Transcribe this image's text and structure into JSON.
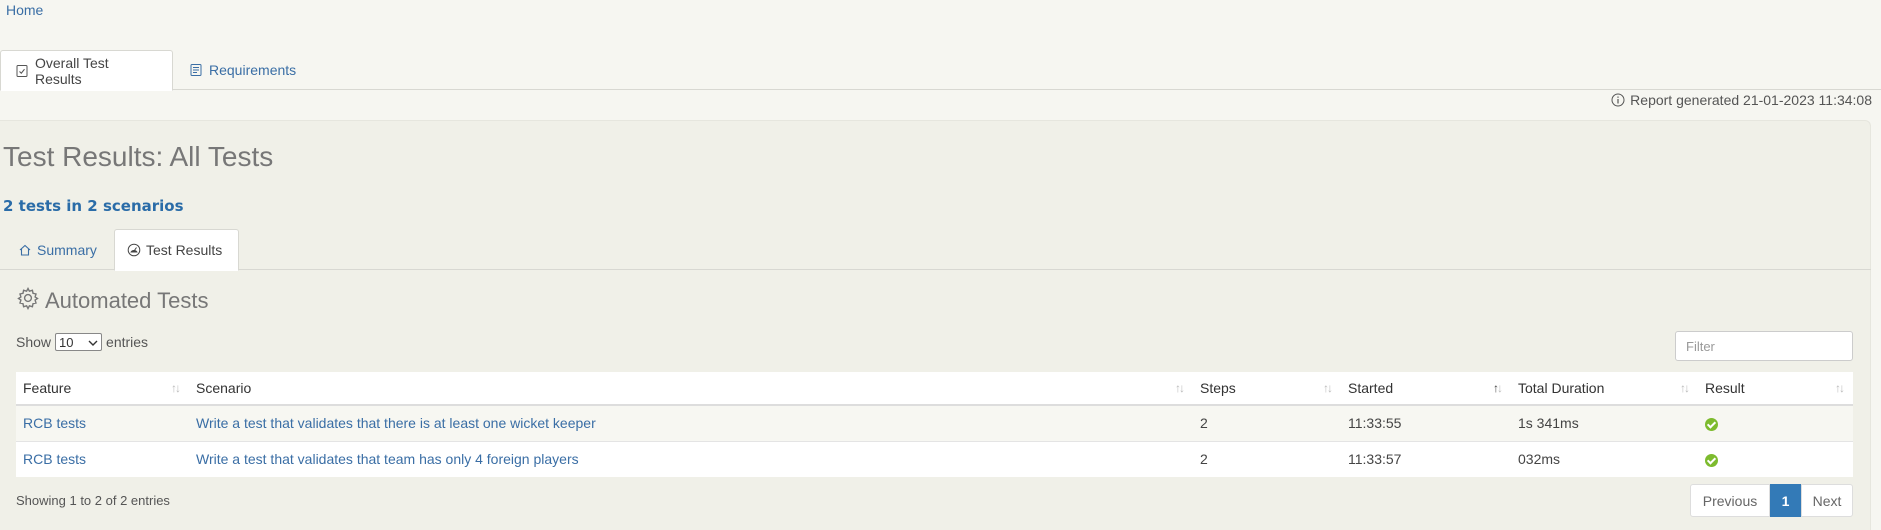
{
  "breadcrumb": {
    "home": "Home"
  },
  "top_tabs": [
    {
      "label": "Overall Test Results",
      "active": true,
      "icon": "checklist-icon"
    },
    {
      "label": "Requirements",
      "active": false,
      "icon": "document-icon"
    }
  ],
  "report": {
    "generated": "Report generated 21-01-2023 11:34:08"
  },
  "page": {
    "title": "Test Results: All Tests",
    "subtitle": "2 tests in 2 scenarios"
  },
  "inner_tabs": [
    {
      "label": "Summary",
      "active": false,
      "icon": "home-icon"
    },
    {
      "label": "Test Results",
      "active": true,
      "icon": "gauge-icon"
    }
  ],
  "section": {
    "title": "Automated Tests"
  },
  "controls": {
    "show_label": "Show",
    "entries_value": "10",
    "entries_label": "entries",
    "filter_placeholder": "Filter"
  },
  "table": {
    "columns": [
      "Feature",
      "Scenario",
      "Steps",
      "Started",
      "Total Duration",
      "Result"
    ],
    "rows": [
      {
        "feature": "RCB tests",
        "scenario": "Write a test that validates that there is at least one wicket keeper",
        "steps": "2",
        "started": "11:33:55",
        "duration": "1s 341ms",
        "result": "passed"
      },
      {
        "feature": "RCB tests",
        "scenario": "Write a test that validates that team has only 4 foreign players",
        "steps": "2",
        "started": "11:33:57",
        "duration": "032ms",
        "result": "passed"
      }
    ]
  },
  "footer": {
    "info": "Showing 1 to 2 of 2 entries"
  },
  "pagination": {
    "previous": "Previous",
    "current": "1",
    "next": "Next"
  },
  "colors": {
    "link": "#3a6ea5",
    "pass": "#7dbb2e",
    "page_active": "#337ab7"
  }
}
